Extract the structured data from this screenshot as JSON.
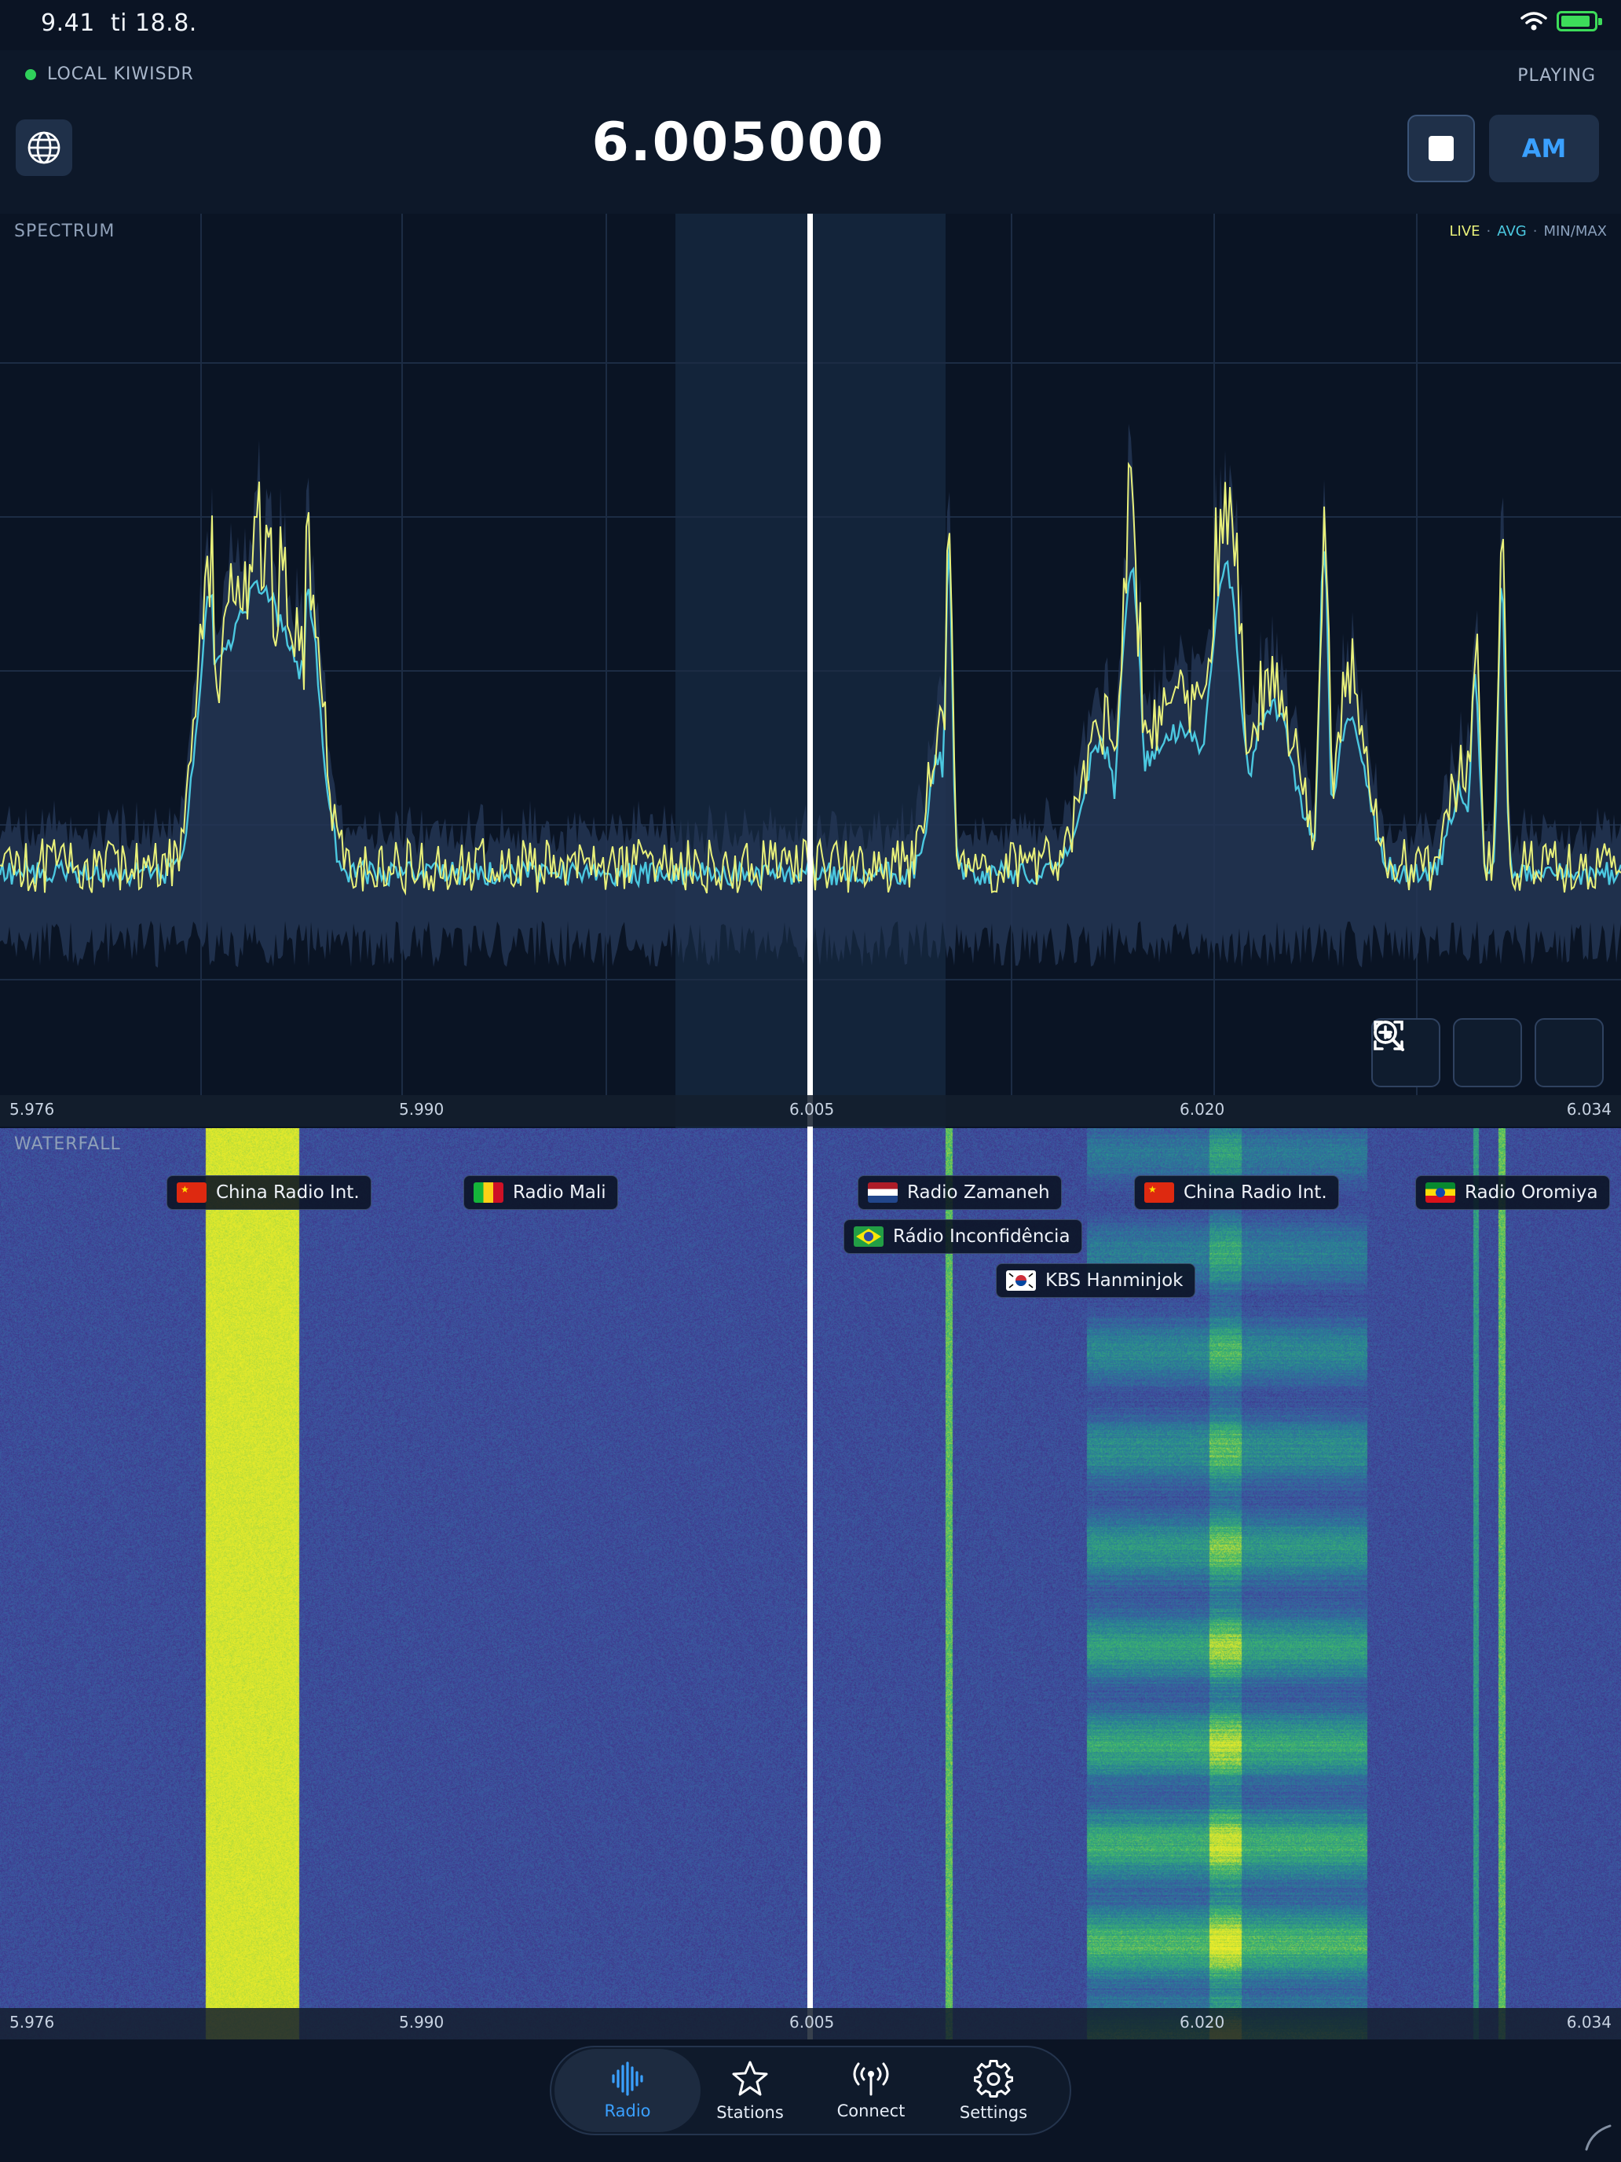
{
  "status": {
    "time": "9.41",
    "date": "ti 18.8."
  },
  "header": {
    "connection": "LOCAL KIWISDR",
    "state": "PLAYING",
    "frequency": "6.005000",
    "mode": "AM"
  },
  "spectrum": {
    "label": "SPECTRUM",
    "legend": {
      "live": "LIVE",
      "avg": "AVG",
      "minmax": "MIN/MAX",
      "sep": "·"
    }
  },
  "waterfall": {
    "label": "WATERFALL"
  },
  "axis": {
    "ticks": [
      "5.976",
      "5.990",
      "6.005",
      "6.020",
      "6.034"
    ]
  },
  "stations": [
    {
      "name": "China Radio Int.",
      "flag": "china-flag-icon"
    },
    {
      "name": "Radio Mali",
      "flag": "mali-flag-icon"
    },
    {
      "name": "Radio Zamaneh",
      "flag": "netherlands-flag-icon"
    },
    {
      "name": "Rádio Inconfidência",
      "flag": "brazil-flag-icon"
    },
    {
      "name": "KBS Hanminjok",
      "flag": "south-korea-flag-icon"
    },
    {
      "name": "China Radio Int.",
      "flag": "china-flag-icon"
    },
    {
      "name": "Radio Oromiya",
      "flag": "ethiopia-flag-icon"
    }
  ],
  "tabs": [
    {
      "label": "Radio",
      "icon": "waveform-icon",
      "active": true
    },
    {
      "label": "Stations",
      "icon": "star-icon",
      "active": false
    },
    {
      "label": "Connect",
      "icon": "antenna-icon",
      "active": false
    },
    {
      "label": "Settings",
      "icon": "gear-icon",
      "active": false
    }
  ],
  "colors": {
    "accent": "#3aa0ff",
    "live_trace": "#e8f07a",
    "avg_trace": "#4bc8e0",
    "connected": "#2fd05a"
  }
}
